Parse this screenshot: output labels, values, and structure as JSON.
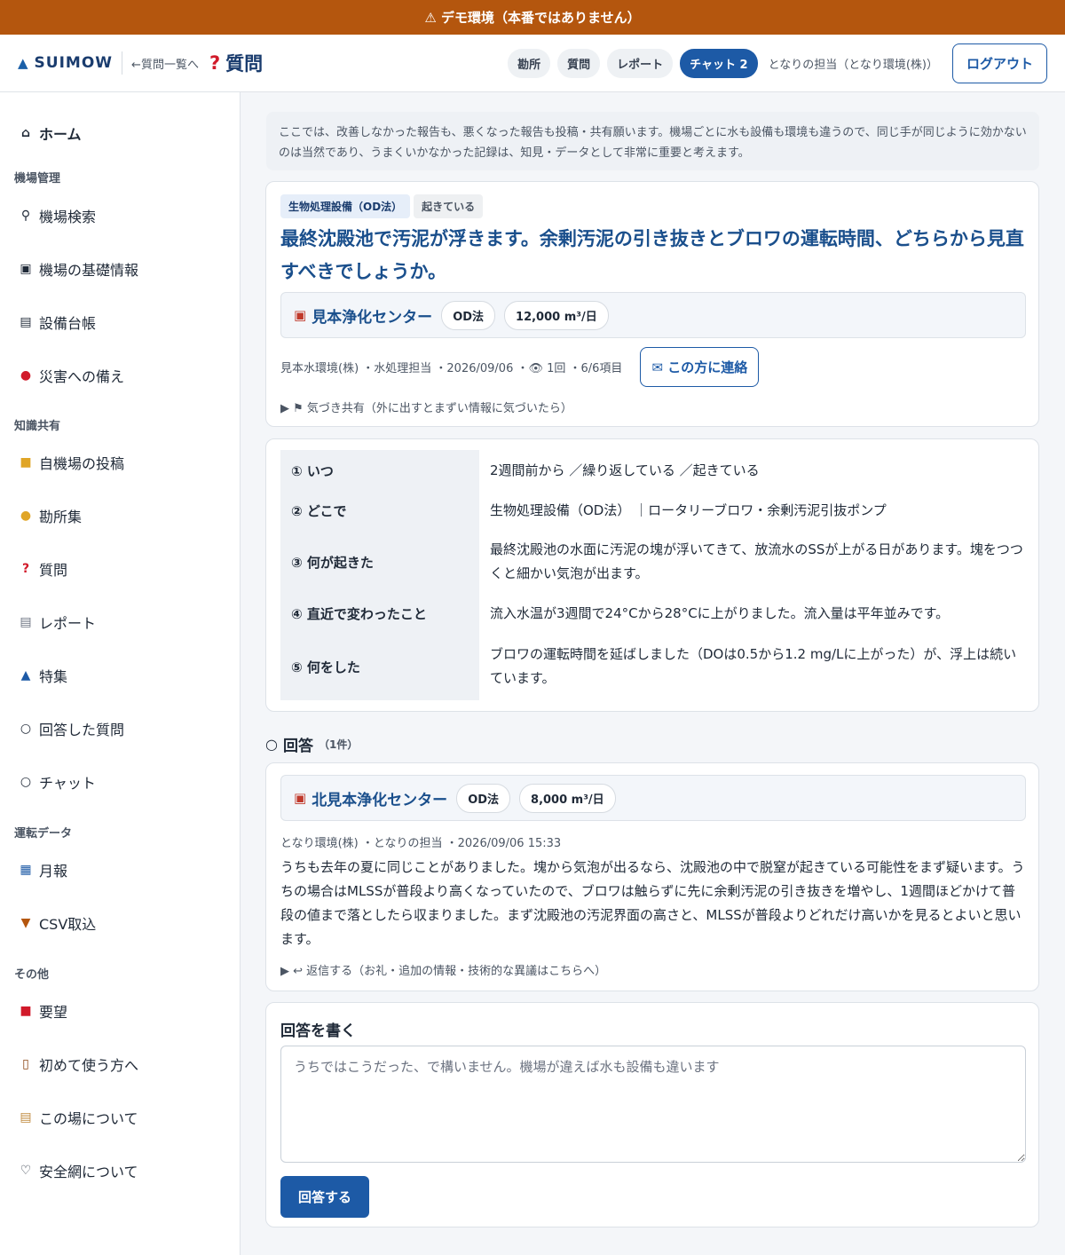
{
  "banner": {
    "icon": "warning-icon",
    "text": "⚠ デモ環境（本番ではありません）"
  },
  "header": {
    "logo_text": "SUIMOW",
    "back_link": "←質問一覧へ",
    "page_title": "質問",
    "nav": [
      {
        "label": "勘所"
      },
      {
        "label": "質問"
      },
      {
        "label": "レポート"
      },
      {
        "label": "チャット 2"
      }
    ],
    "user": "となりの担当（となり環境(株)）",
    "logout": "ログアウト"
  },
  "sidebar": {
    "home": "ホーム",
    "sections": [
      {
        "title": "機場管理",
        "items": [
          "機場検索",
          "機場の基礎情報",
          "設備台帳",
          "災害への備え"
        ]
      },
      {
        "title": "知識共有",
        "items": [
          "自機場の投稿",
          "勘所集",
          "質問",
          "レポート",
          "特集",
          "回答した質問",
          "チャット"
        ]
      },
      {
        "title": "運転データ",
        "items": [
          "月報",
          "CSV取込"
        ]
      },
      {
        "title": "その他",
        "items": [
          "要望",
          "初めて使う方へ",
          "この場について",
          "安全網について"
        ]
      }
    ]
  },
  "notice": "ここでは、改善しなかった報告も、悪くなった報告も投稿・共有願います。機場ごとに水も設備も環境も違うので、同じ手が同じように効かないのは当然であり、うまくいかなかった記録は、知見・データとして非常に重要と考えます。",
  "question": {
    "tags": [
      "生物処理設備（OD法）",
      "起きている"
    ],
    "title": "最終沈殿池で汚泥が浮きます。余剰汚泥の引き抜きとブロワの運転時間、どちらから見直すべきでしょうか。",
    "plant": {
      "name": "見本浄化センター",
      "method": "OD法",
      "capacity": "12,000 m³/日"
    },
    "meta": "見本水環境(株) ・水処理担当 ・2026/09/06 ・👁 1回 ・6/6項目",
    "contact": "✉ この方に連絡",
    "flag_toggle": "▶ ⚑ 気づき共有（外に出すとまずい情報に気づいたら）"
  },
  "details": [
    {
      "key": "① いつ",
      "value": "2週間前から ／繰り返している ／起きている"
    },
    {
      "key": "② どこで",
      "value": "生物処理設備（OD法） ｜ロータリーブロワ・余剰汚泥引抜ポンプ"
    },
    {
      "key": "③ 何が起きた",
      "value": "最終沈殿池の水面に汚泥の塊が浮いてきて、放流水のSSが上がる日があります。塊をつつくと細かい気泡が出ます。"
    },
    {
      "key": "④ 直近で変わったこと",
      "value": "流入水温が3週間で24°Cから28°Cに上がりました。流入量は平年並みです。"
    },
    {
      "key": "⑤ 何をした",
      "value": "ブロワの運転時間を延ばしました（DOは0.5から1.2 mg/Lに上がった）が、浮上は続いています。"
    }
  ],
  "answers_heading": {
    "title": "回答",
    "count": "（1件）"
  },
  "answer": {
    "plant": {
      "name": "北見本浄化センター",
      "method": "OD法",
      "capacity": "8,000 m³/日"
    },
    "meta": "となり環境(株) ・となりの担当 ・2026/09/06 15:33",
    "body": "うちも去年の夏に同じことがありました。塊から気泡が出るなら、沈殿池の中で脱窒が起きている可能性をまず疑います。うちの場合はMLSSが普段より高くなっていたので、ブロワは触らずに先に余剰汚泥の引き抜きを増やし、1週間ほどかけて普段の値まで落としたら収まりました。まず沈殿池の汚泥界面の高さと、MLSSが普段よりどれだけ高いかを見るとよいと思います。",
    "reply_toggle": "▶ ↩ 返信する（お礼・追加の情報・技術的な異議はこちらへ）"
  },
  "reply_form": {
    "title": "回答を書く",
    "placeholder": "うちではこうだった、で構いません。機場が違えば水も設備も違います",
    "value": "",
    "submit": "回答する"
  },
  "colors": {
    "banner": "#b4560e",
    "accent": "#1d5aa6",
    "title": "#1a4f8c"
  }
}
